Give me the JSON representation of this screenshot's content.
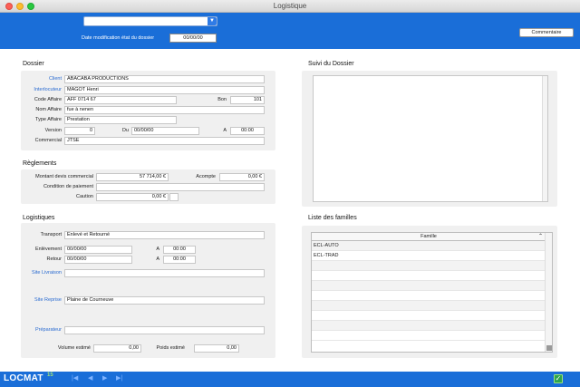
{
  "window": {
    "title": "Logistique"
  },
  "header": {
    "date_label": "Date modification état du dossier",
    "date_value": "00/00/00",
    "comment_button": "Commentaire"
  },
  "dossier": {
    "title": "Dossier",
    "client_label": "Client",
    "client_value": "ABACABA PRODUCTIONS",
    "interlocuteur_label": "Interlocuteur",
    "interlocuteur_value": "MAGOT Henri",
    "code_label": "Code Affaire",
    "code_value": "AFF 0714 67",
    "bon_label": "Bon",
    "bon_value": "101",
    "nom_label": "Nom Affaire",
    "nom_value": "fue à nenen",
    "type_label": "Type Affaire",
    "type_value": "Prestation",
    "version_label": "Version",
    "version_value": "0",
    "du_label": "Du",
    "du_value": "00/00/00",
    "a_label": "A",
    "a_value": "00:00",
    "commercial_label": "Commercial",
    "commercial_value": "JTSE"
  },
  "reglements": {
    "title": "Règlements",
    "montant_label": "Montant devis commercial",
    "montant_value": "57 714,00 €",
    "acompte_label": "Acompte",
    "acompte_value": "0,00 €",
    "condition_label": "Condition de paiement",
    "condition_value": "",
    "caution_label": "Caution",
    "caution_value": "0,00 €"
  },
  "logistiques": {
    "title": "Logistiques",
    "transport_label": "Transport",
    "transport_value": "Enlevé et Retourné",
    "enlevement_label": "Enlèvement",
    "enlevement_value": "00/00/00",
    "enlevement_a_label": "A",
    "enlevement_a_value": "00:00",
    "retour_label": "Retour",
    "retour_value": "00/00/00",
    "retour_a_label": "A",
    "retour_a_value": "00:00",
    "site_livraison_label": "Site Livraison",
    "site_livraison_value": "",
    "site_reprise_label": "Site Reprise",
    "site_reprise_value": "Plaine de Courneuve",
    "preparateur_label": "Préparateur",
    "preparateur_value": "",
    "volume_label": "Volume estimé",
    "volume_value": "0,00",
    "poids_label": "Poids estimé",
    "poids_value": "0,00"
  },
  "suivi": {
    "title": "Suivi du Dossier"
  },
  "familles": {
    "title": "Liste des familles",
    "column": "Famille",
    "rows": [
      "ECL-AUTO",
      "ECL-TRAD",
      "",
      "",
      "",
      "",
      "",
      "",
      "",
      ""
    ]
  },
  "footer": {
    "logo": "LOCMAT",
    "version": "15"
  }
}
